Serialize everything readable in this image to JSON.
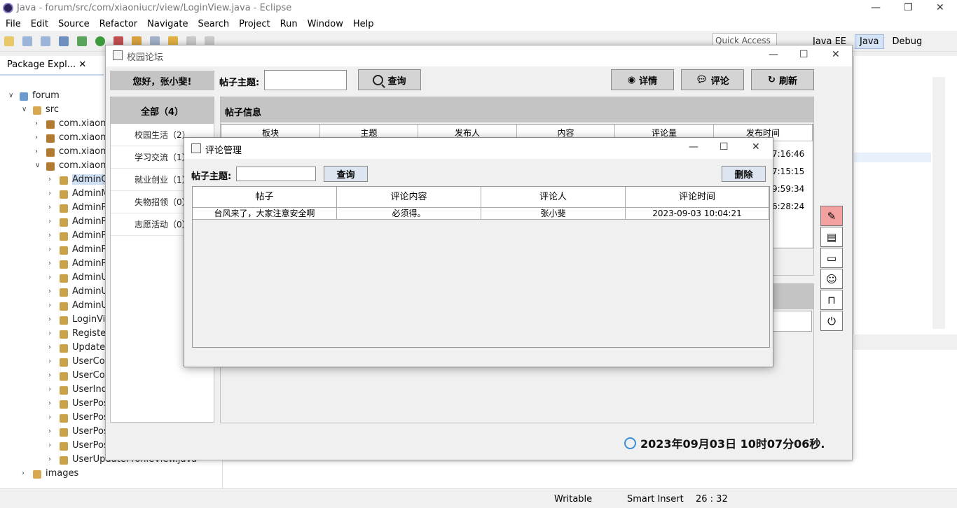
{
  "eclipse": {
    "title": "Java - forum/src/com/xiaoniucr/view/LoginView.java - Eclipse",
    "menu": [
      "File",
      "Edit",
      "Source",
      "Refactor",
      "Navigate",
      "Search",
      "Project",
      "Run",
      "Window",
      "Help"
    ],
    "quick_access": "Quick Access",
    "perspectives": [
      "Java EE",
      "Java",
      "Debug"
    ],
    "package_tab": "Package Expl...",
    "tree": [
      {
        "label": "forum",
        "indent": 1,
        "open": true
      },
      {
        "label": "src",
        "indent": 2,
        "open": true
      },
      {
        "label": "com.xiaoni",
        "indent": 3,
        "open": false
      },
      {
        "label": "com.xiaoni",
        "indent": 3,
        "open": false
      },
      {
        "label": "com.xiaoni",
        "indent": 3,
        "open": false
      },
      {
        "label": "com.xiaoni",
        "indent": 3,
        "open": true
      },
      {
        "label": "AdminC",
        "indent": 4,
        "open": false
      },
      {
        "label": "AdminM",
        "indent": 4,
        "open": false
      },
      {
        "label": "AdminP",
        "indent": 4,
        "open": false
      },
      {
        "label": "AdminP",
        "indent": 4,
        "open": false
      },
      {
        "label": "AdminP",
        "indent": 4,
        "open": false
      },
      {
        "label": "AdminP",
        "indent": 4,
        "open": false
      },
      {
        "label": "AdminP",
        "indent": 4,
        "open": false
      },
      {
        "label": "AdminU",
        "indent": 4,
        "open": false
      },
      {
        "label": "AdminU",
        "indent": 4,
        "open": false
      },
      {
        "label": "AdminU",
        "indent": 4,
        "open": false
      },
      {
        "label": "LoginVi",
        "indent": 4,
        "open": false
      },
      {
        "label": "Registe",
        "indent": 4,
        "open": false
      },
      {
        "label": "Updatel",
        "indent": 4,
        "open": false
      },
      {
        "label": "UserCor",
        "indent": 4,
        "open": false
      },
      {
        "label": "UserCor",
        "indent": 4,
        "open": false
      },
      {
        "label": "UserInd",
        "indent": 4,
        "open": false
      },
      {
        "label": "UserPos",
        "indent": 4,
        "open": false
      },
      {
        "label": "UserPos",
        "indent": 4,
        "open": false
      },
      {
        "label": "UserPos",
        "indent": 4,
        "open": false
      },
      {
        "label": "UserPos",
        "indent": 4,
        "open": false
      },
      {
        "label": "UserUpdateProfileView.java",
        "indent": 4,
        "open": false
      },
      {
        "label": "images",
        "indent": 2,
        "open": false
      }
    ],
    "status": {
      "writable": "Writable",
      "insert": "Smart Insert",
      "position": "26 : 32"
    }
  },
  "forum": {
    "title": "校园论坛",
    "greeting": "您好，张小斐!",
    "topic_label": "帖子主题:",
    "topic_value": "",
    "search_label": "查询",
    "detail_label": "详情",
    "comment_label": "评论",
    "refresh_label": "刷新",
    "sidebar": [
      {
        "label": "全部（4）",
        "active": true
      },
      {
        "label": "校园生活（2）"
      },
      {
        "label": "学习交流（1）"
      },
      {
        "label": "就业创业（1）"
      },
      {
        "label": "失物招领（0）"
      },
      {
        "label": "志愿活动（0）"
      }
    ],
    "post_header": "帖子信息",
    "post_columns": [
      "板块",
      "主题",
      "发布人",
      "内容",
      "评论量",
      "发布时间"
    ],
    "post_times_visible": [
      "7:16:46",
      "7:15:15",
      "9:59:34",
      "6:28:24"
    ],
    "clock": "2023年09月03日 10时07分06秒."
  },
  "dialog": {
    "title": "评论管理",
    "topic_label": "帖子主题:",
    "topic_value": "",
    "search_label": "查询",
    "delete_label": "删除",
    "columns": [
      "帖子",
      "评论内容",
      "评论人",
      "评论时间"
    ],
    "rows": [
      [
        "台风来了，大家注意安全啊",
        "必须得。",
        "张小斐",
        "2023-09-03 10:04:21"
      ]
    ]
  }
}
